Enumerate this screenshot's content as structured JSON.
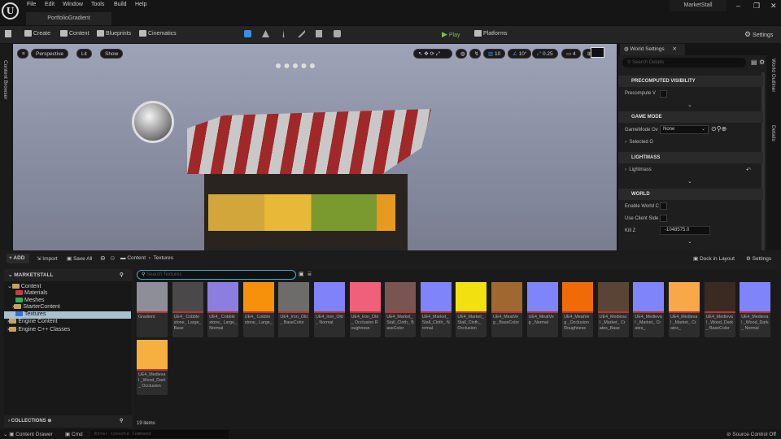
{
  "menu": [
    "File",
    "Edit",
    "Window",
    "Tools",
    "Build",
    "Help"
  ],
  "doc_tab": "PortfolioGradient",
  "window_title": "MarketStall",
  "window_buttons": {
    "minimize": "–",
    "restore": "❐",
    "close": "✕"
  },
  "toolbar": {
    "create": "Create",
    "content": "Content",
    "blueprints": "Blueprints",
    "cinematics": "Cinematics",
    "play": "Play",
    "platforms": "Platforms",
    "settings": "Settings"
  },
  "left_strip": "Content Browser",
  "viewport": {
    "perspective": "Perspective",
    "lit": "Lit",
    "show": "Show",
    "grid_snap": "10",
    "rot_snap": "10°",
    "scale_snap": "0.25",
    "cam_speed": "4"
  },
  "world_settings": {
    "tab": "World Settings",
    "search_placeholder": "Search Details",
    "sections": {
      "precomputed": "PRECOMPUTED VISIBILITY",
      "game_mode": "GAME MODE",
      "lightmass": "LIGHTMASS",
      "world": "WORLD"
    },
    "props": {
      "precompute": "Precompute V",
      "gamemode": "GameMode Ov",
      "gamemode_value": "None",
      "selected": "Selected G",
      "lightmass": "Lightmass",
      "enable_world": "Enable World C",
      "use_client": "Use Client Side",
      "killz": "Kill Z",
      "killz_value": "-1048575.0"
    }
  },
  "right_tabs": {
    "outliner": "World Outliner",
    "details": "Details"
  },
  "content_browser": {
    "add": "ADD",
    "import": "Import",
    "save_all": "Save All",
    "breadcrumb": [
      "Content",
      "Textures"
    ],
    "dock": "Dock in Layout",
    "settings": "Settings",
    "project": "MARKETSTALL",
    "search_placeholder": "Search Textures",
    "collections": "COLLECTIONS",
    "item_count": "19 items",
    "tree": [
      {
        "label": "Content",
        "color": "#c9a25a"
      },
      {
        "label": "Materials",
        "color": "#d0354a"
      },
      {
        "label": "Meshes",
        "color": "#2fb35a"
      },
      {
        "label": "StarterContent",
        "color": "#c9a25a"
      },
      {
        "label": "Textures",
        "color": "#3a6fd8"
      },
      {
        "label": "Engine Content",
        "color": "#c9a25a"
      },
      {
        "label": "Engine C++ Classes",
        "color": "#c9a25a"
      }
    ],
    "assets": [
      {
        "name": "Gradient",
        "color": "#8e8e98"
      },
      {
        "name": "UE4_ Cobblestone_ Large_Base",
        "color": "#4a4848"
      },
      {
        "name": "UE4_ Cobblestone_ Large_Normal",
        "color": "#8c7ee0"
      },
      {
        "name": "UE4_ Cobblestone_ Large_",
        "color": "#f7900a"
      },
      {
        "name": "UE4_Iron_Old_ BaseColor",
        "color": "#6e6c6a"
      },
      {
        "name": "UE4_Iron_Old_ Normal",
        "color": "#8082fa"
      },
      {
        "name": "UE4_Iron_Old_ Occlusion Roughness",
        "color": "#f0607a"
      },
      {
        "name": "UE4_Market_ Stall_Cloth_ BaseColor",
        "color": "#7a5450"
      },
      {
        "name": "UE4_Market_ Stall_Cloth_ Normal",
        "color": "#8084fa"
      },
      {
        "name": "UE4_Market_ Stall_Cloth_ Occlusion",
        "color": "#f2e010"
      },
      {
        "name": "UE4_MeatVeg _BaseColor",
        "color": "#a06830"
      },
      {
        "name": "UE4_MeatVeg _Normal",
        "color": "#8084fa"
      },
      {
        "name": "UE4_MeatVeg _Occlusion Roughness",
        "color": "#f06a08"
      },
      {
        "name": "UE4_Medieval _Market_ Crates_Base",
        "color": "#5a4436"
      },
      {
        "name": "UE4_Medieval _Market_ Crates_",
        "color": "#8084fa"
      },
      {
        "name": "UE4_Medieval _Market_ Crates_",
        "color": "#f8a848"
      },
      {
        "name": "UE4_Medieval _Wood_Dark_ BaseColor",
        "color": "#3a2a22"
      },
      {
        "name": "UE4_Medieval _Wood_Dark_ Normal",
        "color": "#8084fa"
      },
      {
        "name": "UE4_Medieval _Wood_Dark_ Occlusion",
        "color": "#f6b040"
      }
    ]
  },
  "statusbar": {
    "drawer": "Content Drawer",
    "cmd": "Cmd",
    "console_placeholder": "Enter Console Command",
    "source_control": "Source Control Off"
  }
}
